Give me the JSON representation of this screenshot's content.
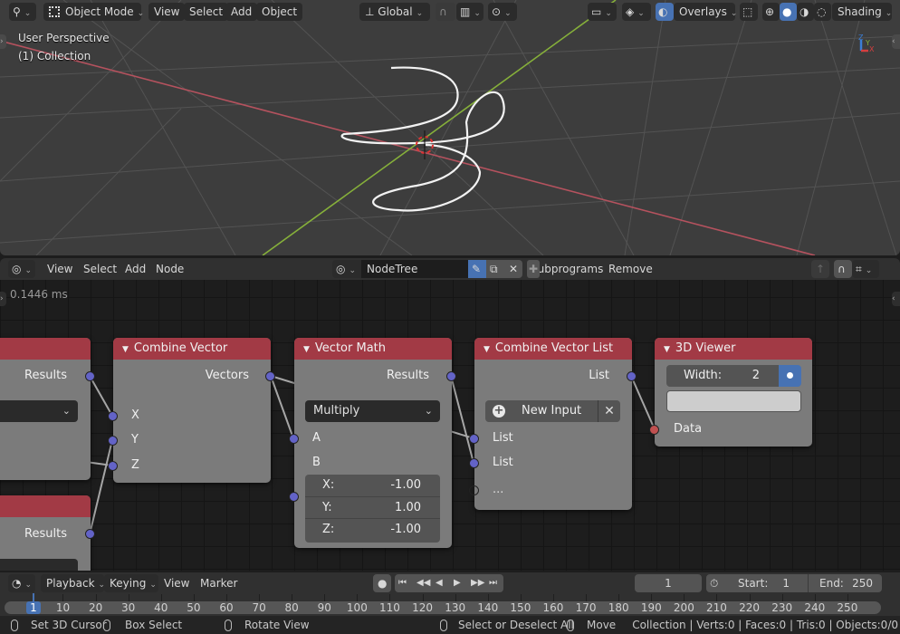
{
  "viewport": {
    "header": {
      "editor_type_icon": "viewport-editor-icon",
      "mode_label": "Object Mode",
      "menus": [
        "View",
        "Select",
        "Add",
        "Object"
      ],
      "transform_orientation": "Global",
      "overlays_label": "Overlays",
      "shading_label": "Shading"
    },
    "overlay_text": {
      "perspective": "User Perspective",
      "collection": "(1) Collection"
    },
    "gizmo_axes": [
      "Z",
      "Y",
      "X"
    ],
    "colors": {
      "x_axis": "#b5525e",
      "y_axis": "#86b03a",
      "background": "#3d3d3d"
    }
  },
  "node_editor": {
    "header": {
      "menus": [
        "View",
        "Select",
        "Add",
        "Node"
      ],
      "tree_name": "NodeTree",
      "subprograms_label": "Subprograms",
      "remove_label": "Remove"
    },
    "timing": "0.1446 ms",
    "nodes": [
      {
        "id": "partial-top",
        "title": "",
        "output": "Results"
      },
      {
        "id": "partial-bottom",
        "title": "",
        "output": "Results"
      },
      {
        "id": "combine-vector",
        "title": "Combine Vector",
        "output": "Vectors",
        "inputs": [
          "X",
          "Y",
          "Z"
        ]
      },
      {
        "id": "vector-math",
        "title": "Vector Math",
        "output": "Results",
        "operation": "Multiply",
        "inputs": [
          "A",
          "B"
        ],
        "b_vector": [
          {
            "k": "X:",
            "v": "-1.00"
          },
          {
            "k": "Y:",
            "v": "1.00"
          },
          {
            "k": "Z:",
            "v": "-1.00"
          }
        ]
      },
      {
        "id": "combine-vector-list",
        "title": "Combine Vector List",
        "output": "List",
        "new_input_label": "New Input",
        "inputs": [
          "List",
          "List",
          "..."
        ]
      },
      {
        "id": "3d-viewer",
        "title": "3D Viewer",
        "width_label": "Width:",
        "width_value": "2",
        "input": "Data"
      }
    ],
    "colors": {
      "node_header": "#a23a45",
      "node_body": "#7b7b7b",
      "vector_socket": "#6363c7",
      "data_socket": "#c05050"
    }
  },
  "timeline": {
    "menus": [
      "Playback",
      "Keying",
      "View",
      "Marker"
    ],
    "current_frame": "1",
    "start_label": "Start:",
    "start": "1",
    "end_label": "End:",
    "end": "250",
    "ruler_ticks": [
      "10",
      "20",
      "30",
      "40",
      "50",
      "60",
      "70",
      "80",
      "90",
      "100",
      "110",
      "120",
      "130",
      "140",
      "150",
      "160",
      "170",
      "180",
      "190",
      "200",
      "210",
      "220",
      "230",
      "240",
      "250"
    ],
    "playhead_frame": "1"
  },
  "statusbar": {
    "left_items": [
      "Set 3D Cursor",
      "Box Select",
      "Rotate View"
    ],
    "mid_items": [
      "Select or Deselect All",
      "Move"
    ],
    "stats": "Collection | Verts:0 | Faces:0 | Tris:0 | Objects:0/0"
  }
}
